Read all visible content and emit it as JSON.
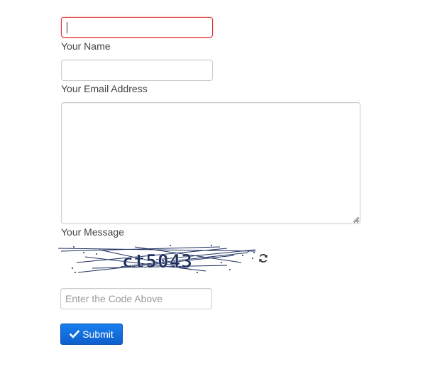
{
  "form": {
    "name": {
      "label": "Your Name",
      "value": ""
    },
    "email": {
      "label": "Your Email Address",
      "value": ""
    },
    "message": {
      "label": "Your Message",
      "value": ""
    },
    "captcha": {
      "code": "ct5043",
      "input_placeholder": "Enter the Code Above",
      "input_value": ""
    },
    "submit": {
      "label": "Submit",
      "icon": "checkmark-icon"
    }
  },
  "colors": {
    "error_border": "#e03131",
    "button": "#1a6fe0",
    "captcha_text": "#1c2f5e"
  },
  "icons": {
    "refresh": "refresh-icon",
    "submit": "checkmark-icon"
  }
}
